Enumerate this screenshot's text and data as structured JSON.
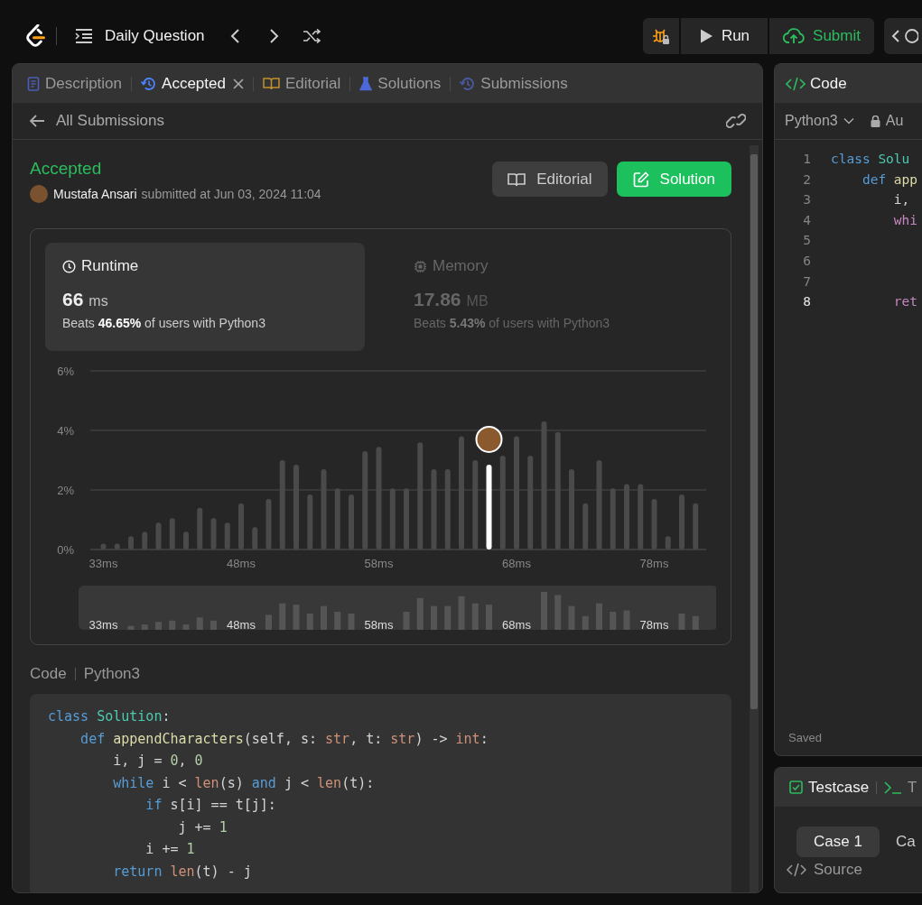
{
  "top_bar": {
    "title": "Daily Question",
    "run_button": "Run",
    "submit_button": "Submit"
  },
  "left_panel": {
    "tabs": [
      {
        "label": "Description",
        "kind": "document",
        "selected": false,
        "closable": false
      },
      {
        "label": "Accepted",
        "kind": "history",
        "selected": true,
        "closable": true
      },
      {
        "label": "Editorial",
        "kind": "book",
        "selected": false,
        "closable": false
      },
      {
        "label": "Solutions",
        "kind": "flask",
        "selected": false,
        "closable": false
      },
      {
        "label": "Submissions",
        "kind": "history",
        "selected": false,
        "closable": false
      }
    ],
    "back_link": "All Submissions",
    "submission": {
      "status": "Accepted",
      "user": "Mustafa Ansari",
      "submitted": "submitted at Jun 03, 2024 11:04",
      "editorial_button": "Editorial",
      "solution_button": "Solution"
    },
    "metrics": [
      {
        "label": "Runtime",
        "kind": "clock",
        "value": "66",
        "unit": "ms",
        "beats": "Beats **46.65%** of users with Python3",
        "selected": true
      },
      {
        "label": "Memory",
        "kind": "chip",
        "value": "17.86",
        "unit": "MB",
        "beats": "Beats **5.43%** of users with Python3",
        "selected": false
      }
    ],
    "chart_data": {
      "type": "bar",
      "stacked": true,
      "categories": [
        "33ms",
        null,
        null,
        null,
        null,
        null,
        null,
        null,
        null,
        null,
        "48ms",
        null,
        null,
        null,
        null,
        null,
        null,
        null,
        null,
        null,
        "58ms",
        null,
        null,
        null,
        null,
        null,
        null,
        null,
        null,
        null,
        "68ms",
        null,
        null,
        null,
        null,
        null,
        null,
        null,
        null,
        null,
        "78ms",
        null,
        null,
        null
      ],
      "ylim": [
        0,
        6
      ],
      "yticks": [
        {
          "value": 0,
          "label": "0%"
        },
        {
          "value": 2,
          "label": "2%"
        },
        {
          "value": 4,
          "label": "4%"
        },
        {
          "value": 6,
          "label": "6%"
        }
      ],
      "series": [
        {
          "color": "#4a4a4a",
          "values": [
            0.2,
            0.2,
            0.45,
            0.6,
            0.9,
            1.05,
            0.6,
            1.4,
            1.05,
            0.9,
            1.55,
            0.75,
            1.7,
            3.0,
            2.85,
            1.85,
            2.7,
            2.05,
            1.85,
            3.3,
            3.45,
            2.05,
            2.05,
            3.6,
            2.7,
            2.7,
            3.8,
            3.0,
            null,
            3.15,
            3.8,
            3.15,
            4.3,
            3.95,
            2.7,
            1.55,
            3.0,
            2.05,
            2.2,
            2.2,
            1.7,
            0.45,
            1.85,
            1.55
          ]
        },
        {
          "color": "#ffffff",
          "values": [
            null,
            null,
            null,
            null,
            null,
            null,
            null,
            null,
            null,
            null,
            null,
            null,
            null,
            null,
            null,
            null,
            null,
            null,
            null,
            null,
            null,
            null,
            null,
            null,
            null,
            null,
            null,
            null,
            2.85,
            null,
            null,
            null,
            null,
            null,
            null,
            null,
            null,
            null,
            null,
            null,
            null,
            null,
            null,
            null
          ]
        }
      ]
    },
    "overview": {
      "labels": [
        "33ms",
        "48ms",
        "58ms",
        "68ms",
        "78ms"
      ]
    },
    "code_label": "Code",
    "code_language": "Python3",
    "code": [
      [
        {
          "text": "class ",
          "kind": "kw"
        },
        {
          "text": "Solution",
          "kind": "cls"
        },
        {
          "text": ":",
          "kind": "plain"
        }
      ],
      [
        {
          "text": "    def ",
          "kind": "kw"
        },
        {
          "text": "appendCharacters",
          "kind": "fn"
        },
        {
          "text": "(self, s: ",
          "kind": "plain"
        },
        {
          "text": "str",
          "kind": "type"
        },
        {
          "text": ", t: ",
          "kind": "plain"
        },
        {
          "text": "str",
          "kind": "type"
        },
        {
          "text": ") -> ",
          "kind": "plain"
        },
        {
          "text": "int",
          "kind": "type"
        },
        {
          "text": ":",
          "kind": "plain"
        }
      ],
      [
        {
          "text": "        i, j = ",
          "kind": "plain"
        },
        {
          "text": "0",
          "kind": "num"
        },
        {
          "text": ", ",
          "kind": "plain"
        },
        {
          "text": "0",
          "kind": "num"
        }
      ],
      [
        {
          "text": "        while",
          "kind": "kw"
        },
        {
          "text": " i < ",
          "kind": "plain"
        },
        {
          "text": "len",
          "kind": "type"
        },
        {
          "text": "(s) ",
          "kind": "plain"
        },
        {
          "text": "and",
          "kind": "kw"
        },
        {
          "text": " j < ",
          "kind": "plain"
        },
        {
          "text": "len",
          "kind": "type"
        },
        {
          "text": "(t):",
          "kind": "plain"
        }
      ],
      [
        {
          "text": "            if",
          "kind": "kw"
        },
        {
          "text": " s[i] == t[j]:",
          "kind": "plain"
        }
      ],
      [
        {
          "text": "                j += ",
          "kind": "plain"
        },
        {
          "text": "1",
          "kind": "num"
        }
      ],
      [
        {
          "text": "            i += ",
          "kind": "plain"
        },
        {
          "text": "1",
          "kind": "num"
        }
      ],
      [
        {
          "text": "        return ",
          "kind": "kw"
        },
        {
          "text": "len",
          "kind": "type"
        },
        {
          "text": "(t) - j",
          "kind": "plain"
        }
      ]
    ]
  },
  "right_panel": {
    "code_tab": "Code",
    "language": "Python3",
    "lock_label": "Au",
    "lines": [
      {
        "number": "1",
        "current": false,
        "tokens": [
          {
            "text": "class ",
            "kind": "kw"
          },
          {
            "text": "Solu",
            "kind": "cls"
          }
        ]
      },
      {
        "number": "2",
        "current": false,
        "tokens": [
          {
            "text": "    def ",
            "kind": "kw"
          },
          {
            "text": "app",
            "kind": "fn"
          }
        ]
      },
      {
        "number": "3",
        "current": false,
        "tokens": [
          {
            "text": "        i,",
            "kind": "plain"
          }
        ]
      },
      {
        "number": "4",
        "current": false,
        "tokens": [
          {
            "text": "        whi",
            "kind": "ctrl"
          }
        ]
      },
      {
        "number": "5",
        "current": false
      },
      {
        "number": "6",
        "current": false
      },
      {
        "number": "7",
        "current": false
      },
      {
        "number": "8",
        "current": true,
        "tokens": [
          {
            "text": "        ret",
            "kind": "ctrl"
          }
        ]
      }
    ],
    "status": "Saved",
    "testcase_tabs": [
      {
        "label": "Testcase",
        "kind": "check",
        "selected": true
      },
      {
        "label": "T",
        "kind": "terminal",
        "selected": false
      }
    ],
    "cases": [
      {
        "label": "Case 1",
        "selected": true
      },
      {
        "label": "Ca",
        "selected": false
      }
    ],
    "source": "Source"
  }
}
